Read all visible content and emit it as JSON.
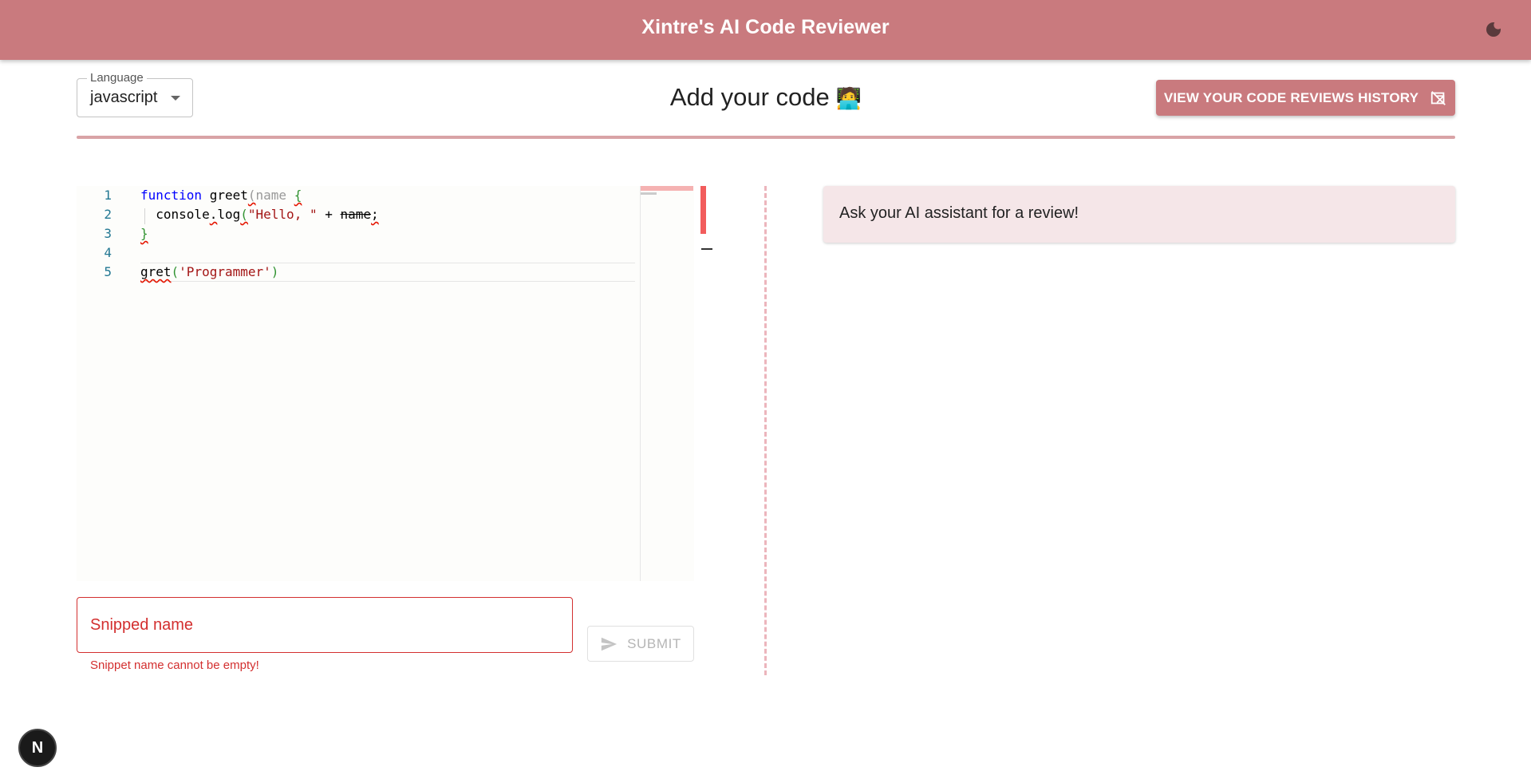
{
  "appbar": {
    "title": "Xintre's AI Code Reviewer",
    "theme_icon": "moon-icon"
  },
  "language_select": {
    "legend": "Language",
    "value": "javascript"
  },
  "header": {
    "title": "Add your code",
    "emoji": "🧑‍💻"
  },
  "history_button": {
    "label": "VIEW YOUR CODE REVIEWS HISTORY",
    "icon": "history-external-icon"
  },
  "editor": {
    "line_numbers": [
      "1",
      "2",
      "3",
      "4",
      "5"
    ],
    "lines": [
      "function greet(name {",
      "  console.log(\"Hello, \" + name;",
      "}",
      "",
      "gret('Programmer')"
    ]
  },
  "snippet": {
    "placeholder": "Snipped name",
    "error": "Snippet name cannot be empty!"
  },
  "submit_button": {
    "label": "SUBMIT",
    "icon": "send-icon"
  },
  "review": {
    "message": "Ask your AI assistant for a review!"
  },
  "badge": {
    "label": "N"
  },
  "colors": {
    "accent": "#c97a7e",
    "error": "#d32f2f",
    "review_bg": "#f5e6e8",
    "divider": "#ecb5bc"
  }
}
